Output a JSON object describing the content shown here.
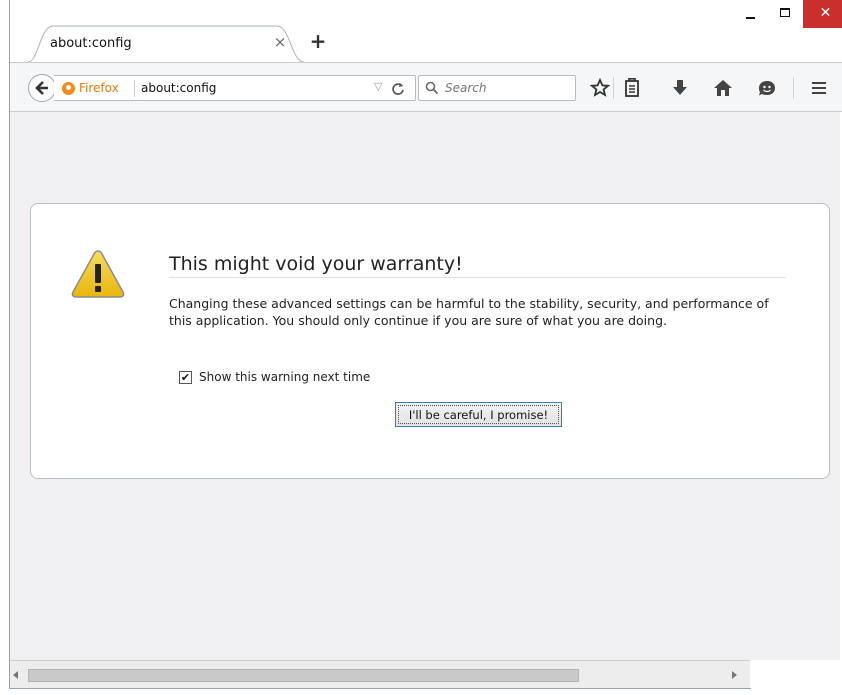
{
  "window": {
    "minimize_label": "minimize",
    "maximize_label": "maximize",
    "close_glyph": "✕"
  },
  "tab": {
    "title": "about:config",
    "close_glyph": "×",
    "newtab_glyph": "+"
  },
  "toolbar": {
    "back_glyph": "🡐",
    "identity_label": "Firefox",
    "url": "about:config",
    "dropmarker_glyph": "▽",
    "reload_glyph": "C",
    "search_placeholder": "Search",
    "icons": [
      "star-icon",
      "reading-list-icon",
      "download-icon",
      "home-icon",
      "hello-icon",
      "menu-icon"
    ]
  },
  "warning": {
    "title": "This might void your warranty!",
    "body": "Changing these advanced settings can be harmful to the stability, security, and performance of this application. You should only continue if you are sure of what you are doing.",
    "checkbox_label": "Show this warning next time",
    "checkbox_checked": true,
    "button_label": "I'll be careful, I promise!"
  },
  "colors": {
    "close_button": "#c9302c",
    "identity": "#e07b14",
    "content_bg": "#f0f0f2",
    "warning_icon": "#f1c21b"
  }
}
